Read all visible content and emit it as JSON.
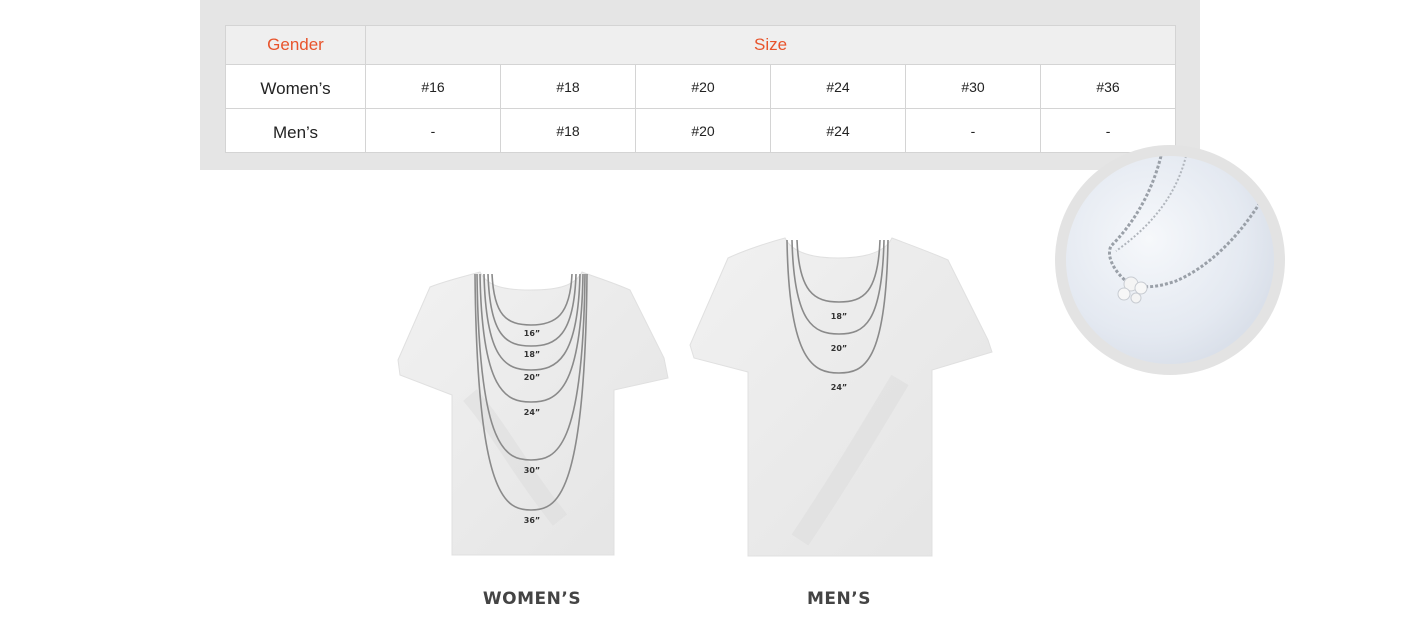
{
  "table": {
    "header_gender": "Gender",
    "header_size": "Size",
    "rows": [
      {
        "gender": "Women’s",
        "sizes": [
          "#16",
          "#18",
          "#20",
          "#24",
          "#30",
          "#36"
        ]
      },
      {
        "gender": "Men’s",
        "sizes": [
          "-",
          "#18",
          "#20",
          "#24",
          "-",
          "-"
        ]
      }
    ]
  },
  "womens": {
    "caption": "WOMEN’S",
    "lengths": [
      "16”",
      "18”",
      "20”",
      "24”",
      "30”",
      "36”"
    ]
  },
  "mens": {
    "caption": "MEN’S",
    "lengths": [
      "18”",
      "20”",
      "24”"
    ]
  },
  "photo": {
    "subject": "necklace-photo"
  },
  "colors": {
    "header_text": "#e8542c",
    "panel_bg": "#e5e5e5",
    "shirt": "#ececec",
    "chain": "#8a8a8a"
  }
}
